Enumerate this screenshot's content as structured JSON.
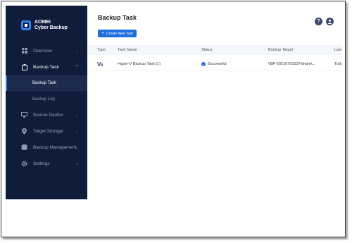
{
  "brand": {
    "line1": "AOMEI",
    "line2": "Cyber Backup"
  },
  "sidebar": {
    "items": [
      {
        "label": "Overview",
        "icon": "overview-icon"
      },
      {
        "label": "Backup Task",
        "icon": "backup-task-icon"
      },
      {
        "label": "Source Device",
        "icon": "source-device-icon"
      },
      {
        "label": "Target Storage",
        "icon": "target-storage-icon"
      },
      {
        "label": "Backup Management",
        "icon": "backup-management-icon"
      },
      {
        "label": "Settings",
        "icon": "settings-icon"
      }
    ],
    "subitems": [
      {
        "label": "Backup Task",
        "active": true
      },
      {
        "label": "Backup Log",
        "active": false
      }
    ]
  },
  "header": {
    "title": "Backup Task",
    "create_label": "Create New Task",
    "help_icon": "help-icon",
    "user_icon": "user-icon"
  },
  "table": {
    "columns": [
      "Type",
      "Task Name",
      "Status",
      "Backup Target",
      "Last"
    ],
    "rows": [
      {
        "type_icon": "hyper-v-icon",
        "task_name": "Hyper-V Backup Task (1)",
        "status": "Successful",
        "target": "\\\\BF-20210701537\\share\\...",
        "last": "Toda"
      }
    ]
  },
  "colors": {
    "sidebar": "#0f1c3b",
    "accent": "#1d6fe0"
  }
}
